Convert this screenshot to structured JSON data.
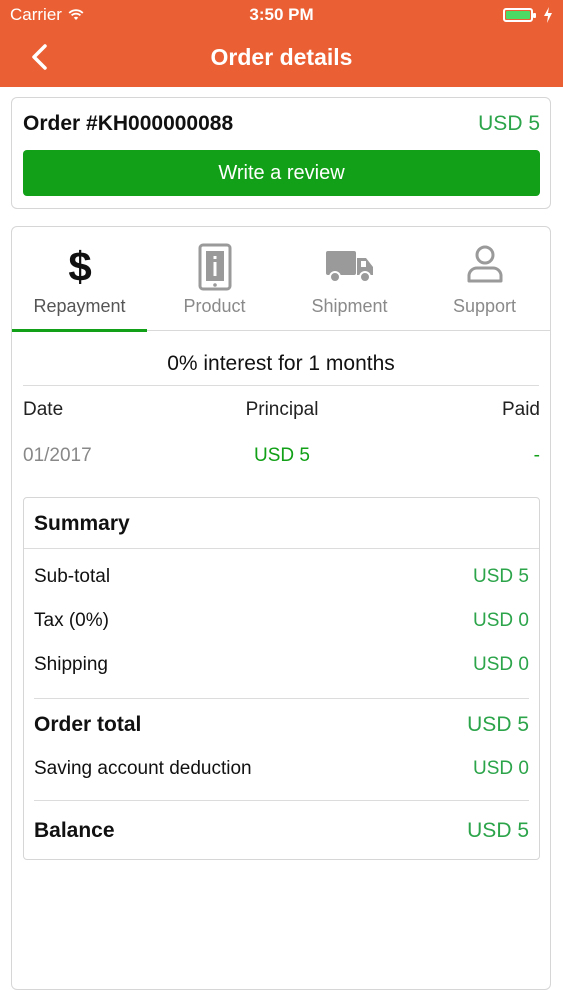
{
  "status_bar": {
    "carrier": "Carrier",
    "time": "3:50 PM",
    "battery_level": 1.0
  },
  "nav": {
    "title": "Order details",
    "back_icon": "chevron-left-icon"
  },
  "order": {
    "id_label": "Order #KH000000088",
    "amount": "USD 5",
    "review_button": "Write a review"
  },
  "tabs": [
    {
      "label": "Repayment",
      "icon": "dollar-icon",
      "active": true
    },
    {
      "label": "Product",
      "icon": "product-info-icon",
      "active": false
    },
    {
      "label": "Shipment",
      "icon": "truck-icon",
      "active": false
    },
    {
      "label": "Support",
      "icon": "person-icon",
      "active": false
    }
  ],
  "repayment": {
    "interest_text": "0% interest for 1 months",
    "columns": [
      "Date",
      "Principal",
      "Paid"
    ],
    "rows": [
      {
        "date": "01/2017",
        "principal": "USD 5",
        "paid": "-"
      }
    ]
  },
  "summary": {
    "title": "Summary",
    "subtotal_label": "Sub-total",
    "subtotal_value": "USD 5",
    "tax_label": "Tax (0%)",
    "tax_value": "USD 0",
    "shipping_label": "Shipping",
    "shipping_value": "USD 0",
    "order_total_label": "Order total",
    "order_total_value": "USD 5",
    "saving_label": "Saving account deduction",
    "saving_value": "USD 0",
    "balance_label": "Balance",
    "balance_value": "USD 5"
  },
  "colors": {
    "header": "#ea6034",
    "accent_green": "#11a017",
    "value_green": "#2ca44a"
  }
}
